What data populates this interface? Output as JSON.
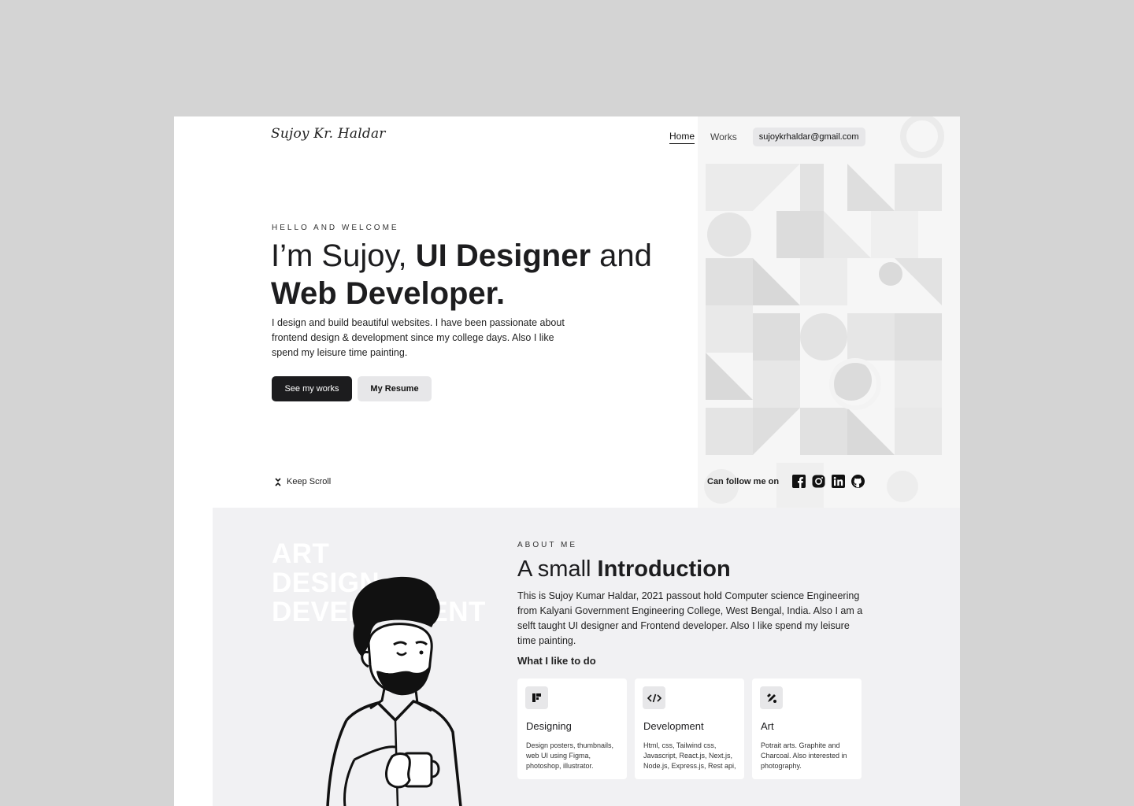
{
  "header": {
    "logo": "Sujoy Kr. Haldar",
    "nav": {
      "home": "Home",
      "works": "Works",
      "email": "sujoykrhaldar@gmail.com"
    }
  },
  "hero": {
    "eyebrow": "HELLO AND WELCOME",
    "title_part1": "I’m Sujoy, ",
    "title_bold1": "UI Designer",
    "title_part2": " and",
    "title_bold2": "Web Developer.",
    "description": "I design and build beautiful websites. I have been passionate about frontend design & development since my college days. Also I like spend my leisure time painting.",
    "primary_button": "See my works",
    "secondary_button": "My Resume",
    "scroll_label": "Keep Scroll",
    "follow_label": "Can follow me on",
    "socials": [
      "facebook-icon",
      "instagram-icon",
      "linkedin-icon",
      "github-icon"
    ]
  },
  "about": {
    "bg_words": [
      "ART",
      "DESIGN",
      "DEVELOPMENT"
    ],
    "eyebrow": "ABOUT ME",
    "title_part": "A small ",
    "title_bold": "Introduction",
    "description": "This is Sujoy Kumar Haldar, 2021 passout hold Computer science Engineering from Kalyani Government Engineering College, West Bengal, India. Also I am a selft taught UI designer and Frontend developer. Also I like spend my leisure time painting.",
    "like_title": "What I like to do",
    "cards": [
      {
        "icon": "design-icon",
        "title": "Designing",
        "desc": "Design posters, thumbnails, web UI using Figma, photoshop, illustrator."
      },
      {
        "icon": "code-icon",
        "title": "Development",
        "desc": "Html, css, Tailwind css, Javascript, React.js, Next.js, Node.js, Express.js, Rest api,"
      },
      {
        "icon": "paint-icon",
        "title": "Art",
        "desc": "Potrait arts. Graphite and Charcoal. Also interested in photography."
      }
    ]
  },
  "colors": {
    "page_bg": "#d4d4d4",
    "dark": "#1c1c1e",
    "light_button": "#e7e7e9",
    "about_bg": "#f1f1f3"
  }
}
